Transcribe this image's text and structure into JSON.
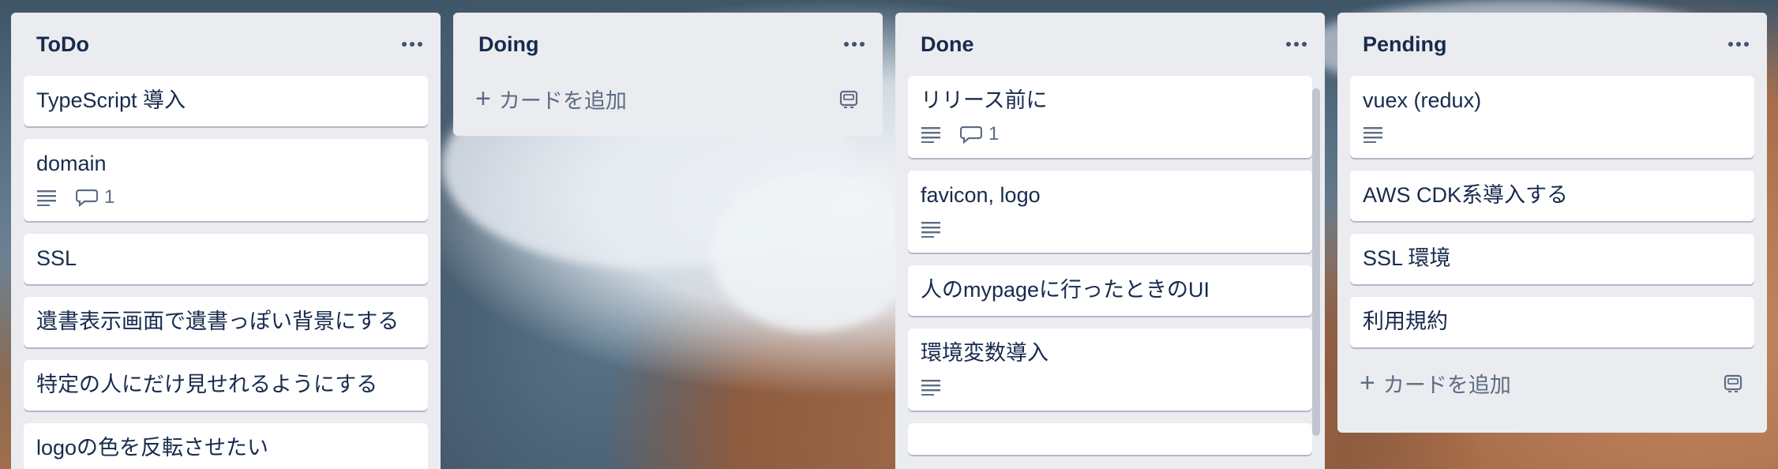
{
  "lists": [
    {
      "title": "ToDo",
      "cards": [
        {
          "title": "TypeScript 導入"
        },
        {
          "title": "domain",
          "comments": "1"
        },
        {
          "title": "SSL"
        },
        {
          "title": "遺書表示画面で遺書っぽい背景にする"
        },
        {
          "title": "特定の人にだけ見せれるようにする"
        },
        {
          "title": "logoの色を反転させたい"
        }
      ]
    },
    {
      "title": "Doing",
      "add_card_label": "カードを追加"
    },
    {
      "title": "Done",
      "cards": [
        {
          "title": "リリース前に",
          "comments": "1"
        },
        {
          "title": "favicon, logo"
        },
        {
          "title": "人のmypageに行ったときのUI"
        },
        {
          "title": "環境変数導入"
        }
      ]
    },
    {
      "title": "Pending",
      "cards": [
        {
          "title": "vuex (redux)"
        },
        {
          "title": "AWS CDK系導入する"
        },
        {
          "title": "SSL 環境"
        },
        {
          "title": "利用規約"
        }
      ],
      "add_card_label": "カードを追加"
    }
  ]
}
